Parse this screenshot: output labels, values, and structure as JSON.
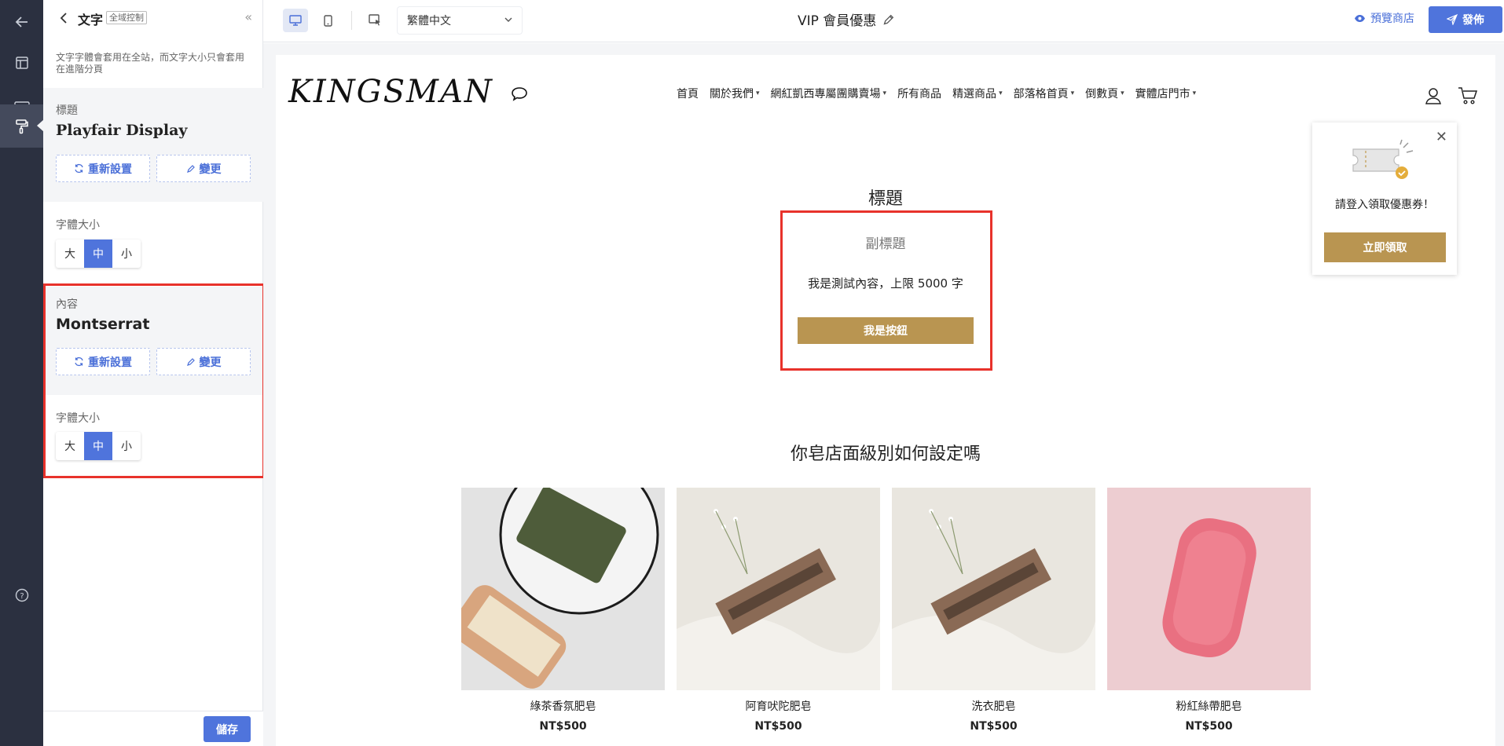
{
  "panel": {
    "title": "文字",
    "tag": "全域控制",
    "collapse": "«",
    "description": "文字字體會套用在全站，而文字大小只會套用在進階分頁",
    "heading_section": {
      "label": "標題",
      "font_name": "Playfair Display",
      "reset_label": "重新設置",
      "change_label": "變更"
    },
    "heading_size": {
      "label": "字體大小",
      "options": [
        "大",
        "中",
        "小"
      ],
      "selected": "中"
    },
    "content_section": {
      "label": "內容",
      "font_name": "Montserrat",
      "reset_label": "重新設置",
      "change_label": "變更"
    },
    "content_size": {
      "label": "字體大小",
      "options": [
        "大",
        "中",
        "小"
      ],
      "selected": "中"
    },
    "save_label": "儲存"
  },
  "toolbar": {
    "language": "繁體中文",
    "page_name": "VIP 會員優惠",
    "preview_label": "預覽商店",
    "publish_label": "發佈"
  },
  "site": {
    "logo": "KINGSMAN",
    "nav": [
      {
        "label": "首頁",
        "dropdown": false
      },
      {
        "label": "關於我們",
        "dropdown": true
      },
      {
        "label": "網紅凱西專屬團購賣場",
        "dropdown": true
      },
      {
        "label": "所有商品",
        "dropdown": false
      },
      {
        "label": "精選商品",
        "dropdown": true
      },
      {
        "label": "部落格首頁",
        "dropdown": true
      },
      {
        "label": "倒數頁",
        "dropdown": true
      },
      {
        "label": "實體店門市",
        "dropdown": true
      }
    ],
    "popup": {
      "text": "請登入領取優惠券！",
      "button": "立即領取"
    },
    "hero": {
      "title": "標題",
      "subtitle": "副標題",
      "body": "我是測試內容，上限 5000 字",
      "button": "我是按鈕"
    },
    "section_title": "你皂店面級別如何設定嗎",
    "products": [
      {
        "name": "綠茶香氛肥皂",
        "price": "NT$500"
      },
      {
        "name": "阿育吠陀肥皂",
        "price": "NT$500"
      },
      {
        "name": "洗衣肥皂",
        "price": "NT$500"
      },
      {
        "name": "粉紅絲帶肥皂",
        "price": "NT$500"
      }
    ]
  },
  "colors": {
    "accent": "#4f74dc",
    "brand_gold": "#b99551",
    "highlight_red": "#e8322b",
    "rail_bg": "#2b3040"
  }
}
